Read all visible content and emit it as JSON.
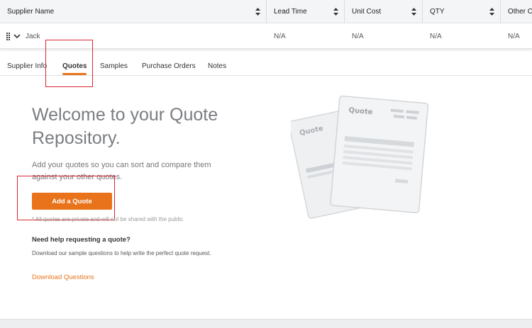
{
  "table": {
    "headers": [
      "Supplier Name",
      "Lead Time",
      "Unit Cost",
      "QTY",
      "Other C"
    ],
    "row": {
      "supplier": "Jack",
      "lead_time": "N/A",
      "unit_cost": "N/A",
      "qty": "N/A",
      "other": "N/A"
    }
  },
  "tabs": [
    "Supplier Info",
    "Quotes",
    "Samples",
    "Purchase Orders",
    "Notes"
  ],
  "active_tab": "Quotes",
  "main": {
    "title": "Welcome to your Quote Repository.",
    "subtitle": "Add your quotes so you can sort and compare them against your other quotes.",
    "add_button": "Add a Quote",
    "privacy_note": "* All quotes are private and will not be shared with the public.",
    "help_heading": "Need help requesting a quote?",
    "help_text": "Download our sample questions to help write the perfect quote request.",
    "download_link": "Download Questions"
  },
  "illustration": {
    "back_label": "Quote",
    "front_label": "Quote"
  },
  "colors": {
    "accent": "#e8731a",
    "highlight": "#d9262e"
  }
}
